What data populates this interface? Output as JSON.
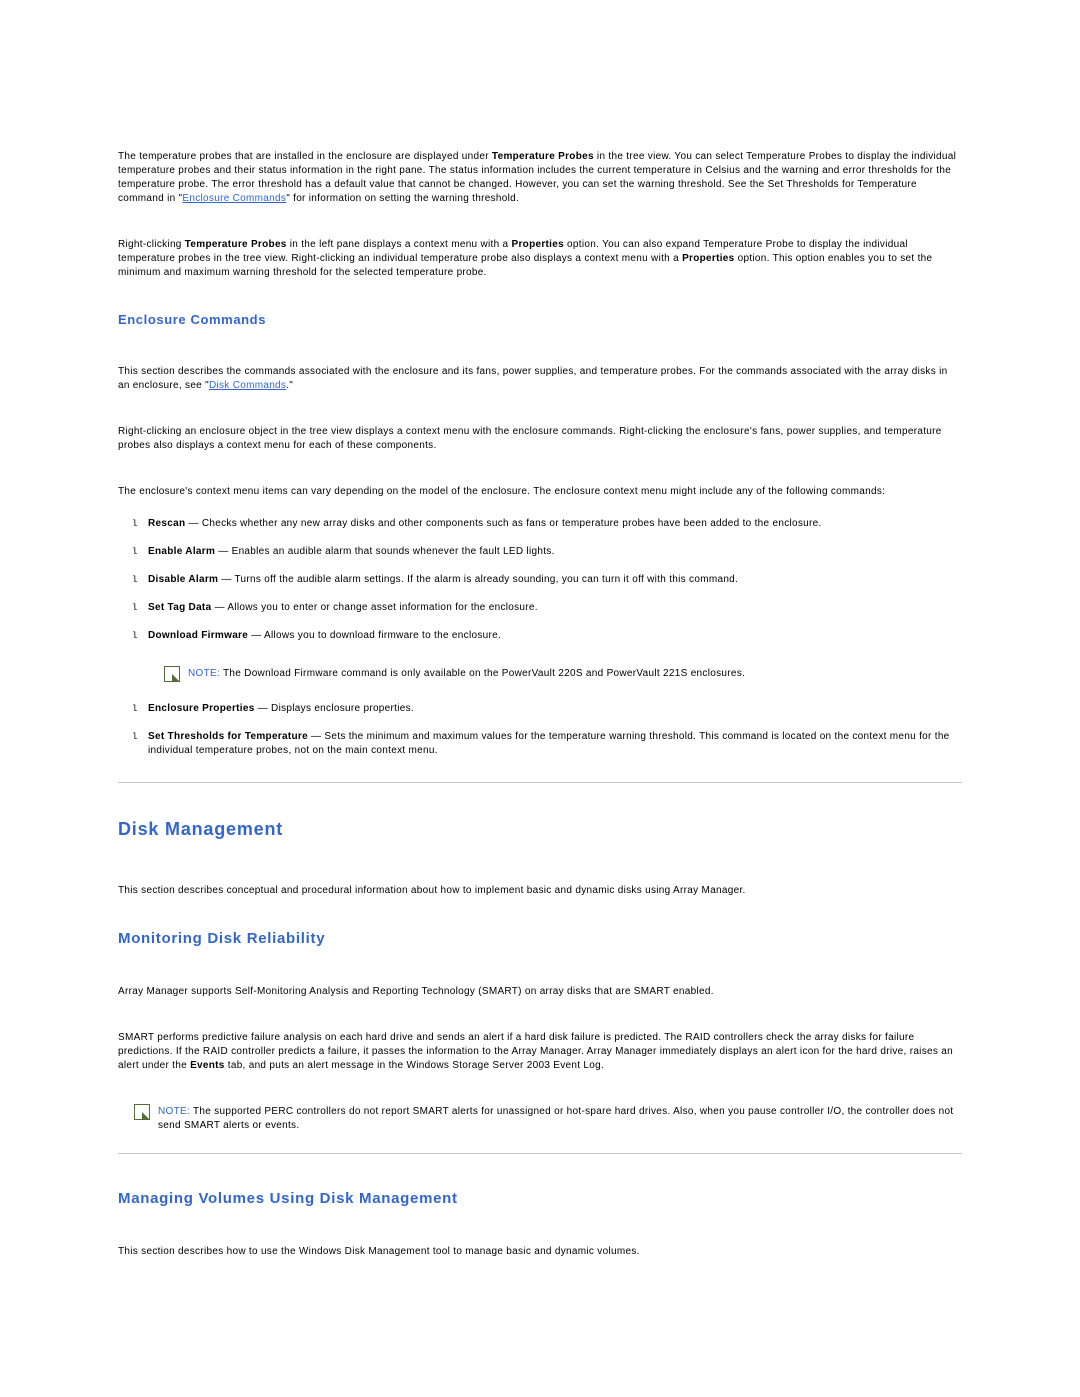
{
  "intro": {
    "p1_a": "The temperature probes that are installed in the enclosure are displayed under ",
    "p1_b": "Temperature Probes",
    "p1_c": " in the tree view. You can select Temperature Probes to display the individual temperature probes and their status information in the right pane. The status information includes the current temperature in Celsius and the warning and error thresholds for the temperature probe. The error threshold has a default value that cannot be changed. However, you can set the warning threshold. See the Set Thresholds for Temperature command in \"",
    "p1_link": "Enclosure Commands",
    "p1_d": "\" for information on setting the warning threshold.",
    "p2_a": "Right-clicking ",
    "p2_b": "Temperature Probes",
    "p2_c": " in the left pane displays a context menu with a ",
    "p2_d": "Properties",
    "p2_e": " option. You can also expand Temperature Probe to display the individual temperature probes in the tree view. Right-clicking an individual temperature probe also displays a context menu with a ",
    "p2_f": "Properties",
    "p2_g": " option. This option enables you to set the minimum and maximum warning threshold for the selected temperature probe."
  },
  "enclosure": {
    "heading": "Enclosure Commands",
    "p1_a": "This section describes the commands associated with the enclosure and its fans, power supplies, and temperature probes. For the commands associated with the array disks in an enclosure, see \"",
    "p1_link": "Disk Commands",
    "p1_b": ".\"",
    "p2": "Right-clicking an enclosure object in the tree view displays a context menu with the enclosure commands. Right-clicking the enclosure's fans, power supplies, and temperature probes also displays a context menu for each of these components.",
    "p3": "The enclosure's context menu items can vary depending on the model of the enclosure. The enclosure context menu might include any of the following commands:",
    "items": [
      {
        "b": "Rescan",
        "t": " — Checks whether any new array disks and other components such as fans or temperature probes have been added to the enclosure."
      },
      {
        "b": "Enable Alarm",
        "t": " — Enables an audible alarm that sounds whenever the fault LED lights."
      },
      {
        "b": "Disable Alarm",
        "t": " — Turns off the audible alarm settings. If the alarm is already sounding, you can turn it off with this command."
      },
      {
        "b": "Set Tag Data",
        "t": " — Allows you to enter or change asset information for the enclosure."
      },
      {
        "b": "Download Firmware",
        "t": " — Allows you to download firmware to the enclosure."
      }
    ],
    "note_label": "NOTE: ",
    "note_text": "The Download Firmware command is only available on the PowerVault 220S and PowerVault 221S enclosures.",
    "items2": [
      {
        "b": "Enclosure Properties",
        "t": " — Displays enclosure properties."
      },
      {
        "b": "Set Thresholds for Temperature",
        "t": " — Sets the minimum and maximum values for the temperature warning threshold. This command is located on the context menu for the individual temperature probes, not on the main context menu."
      }
    ]
  },
  "disk": {
    "heading": "Disk Management",
    "intro": "This section describes conceptual and procedural information about how to implement basic and dynamic disks using Array Manager.",
    "monitor_heading": "Monitoring Disk Reliability",
    "monitor_p1": "Array Manager supports Self-Monitoring Analysis and Reporting Technology (SMART) on array disks that are SMART enabled.",
    "monitor_p2_a": "SMART performs predictive failure analysis on each hard drive and sends an alert if a hard disk failure is predicted. The RAID controllers check the array disks for failure predictions. If the RAID controller predicts a failure, it passes the information to the Array Manager. Array Manager immediately displays an alert icon for the hard drive, raises an alert under the ",
    "monitor_p2_b": "Events",
    "monitor_p2_c": " tab, and puts an alert message in the Windows Storage Server 2003 Event Log.",
    "note_label": "NOTE: ",
    "note_text": "The supported PERC controllers do not report SMART alerts for unassigned or hot-spare hard drives. Also, when you pause controller I/O, the controller does not send SMART alerts or events.",
    "volumes_heading": "Managing Volumes Using Disk Management",
    "volumes_p1": "This section describes how to use the Windows Disk Management tool to manage basic and dynamic volumes."
  }
}
